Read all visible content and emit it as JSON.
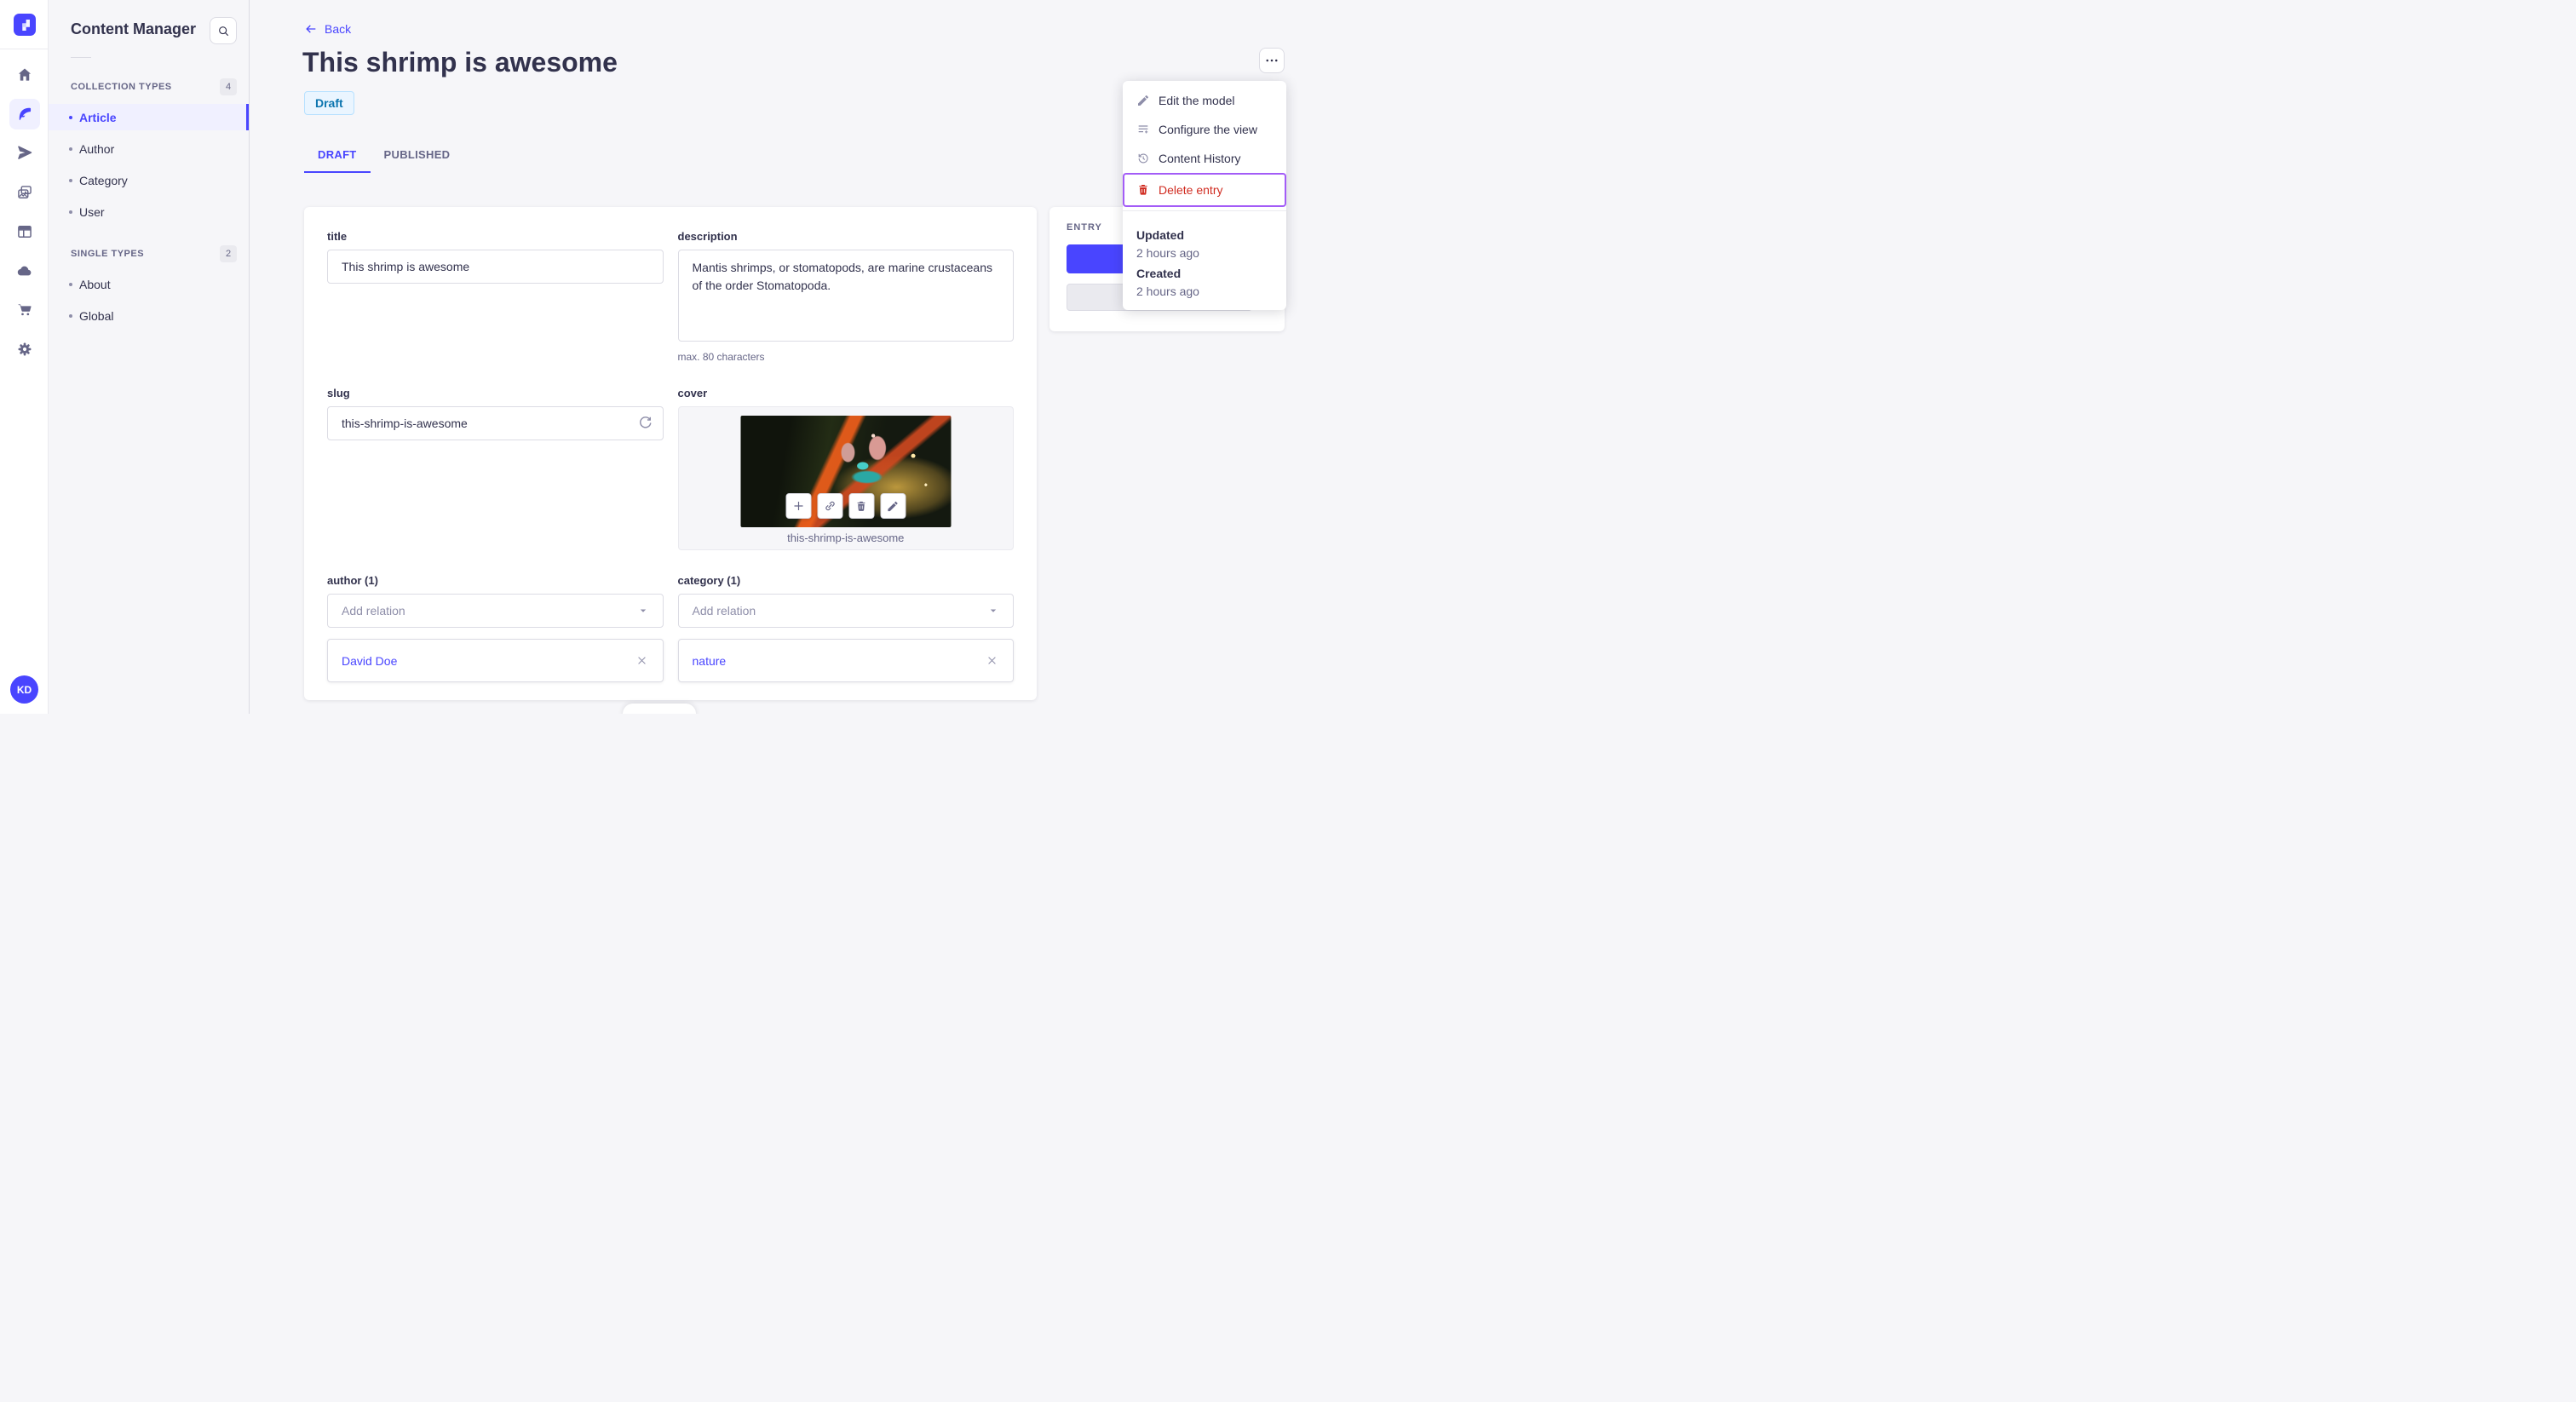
{
  "colors": {
    "primary": "#4945ff",
    "primary_bg": "#f0f0ff",
    "danger": "#d02b20",
    "focus_ring": "#a35cf7",
    "text": "#32324d",
    "muted": "#666687",
    "draft_badge_bg": "#eaf5ff",
    "draft_badge_text": "#0c75af"
  },
  "rail": {
    "logo_icon": "strapi-logo",
    "items": [
      {
        "icon": "home-icon",
        "active": false
      },
      {
        "icon": "feather-icon",
        "active": true
      },
      {
        "icon": "paper-plane-icon",
        "active": false
      },
      {
        "icon": "media-library-icon",
        "active": false
      },
      {
        "icon": "layout-icon",
        "active": false
      },
      {
        "icon": "cloud-icon",
        "active": false
      },
      {
        "icon": "cart-icon",
        "active": false
      },
      {
        "icon": "gear-icon",
        "active": false
      }
    ],
    "avatar": "KD"
  },
  "subnav": {
    "title": "Content Manager",
    "sections": [
      {
        "label": "COLLECTION TYPES",
        "count": "4",
        "items": [
          {
            "label": "Article",
            "active": true
          },
          {
            "label": "Author",
            "active": false
          },
          {
            "label": "Category",
            "active": false
          },
          {
            "label": "User",
            "active": false
          }
        ]
      },
      {
        "label": "SINGLE TYPES",
        "count": "2",
        "items": [
          {
            "label": "About",
            "active": false
          },
          {
            "label": "Global",
            "active": false
          }
        ]
      }
    ]
  },
  "header": {
    "back_label": "Back",
    "title": "This shrimp is awesome",
    "status_badge": "Draft",
    "tabs": [
      {
        "label": "DRAFT",
        "active": true
      },
      {
        "label": "PUBLISHED",
        "active": false
      }
    ]
  },
  "form": {
    "title": {
      "label": "title",
      "value": "This shrimp is awesome"
    },
    "description": {
      "label": "description",
      "value": "Mantis shrimps, or stomatopods, are marine crustaceans of the order Stomatopoda.",
      "helper": "max. 80 characters"
    },
    "slug": {
      "label": "slug",
      "value": "this-shrimp-is-awesome"
    },
    "cover": {
      "label": "cover",
      "caption": "this-shrimp-is-awesome"
    },
    "author": {
      "label": "author (1)",
      "placeholder": "Add relation",
      "items": [
        {
          "label": "David Doe"
        }
      ]
    },
    "category": {
      "label": "category (1)",
      "placeholder": "Add relation",
      "items": [
        {
          "label": "nature"
        }
      ]
    }
  },
  "entry_panel": {
    "label": "ENTRY"
  },
  "menu": {
    "items": [
      {
        "label": "Edit the model",
        "icon": "pencil-icon"
      },
      {
        "label": "Configure the view",
        "icon": "configure-view-icon"
      },
      {
        "label": "Content History",
        "icon": "history-icon"
      },
      {
        "label": "Delete entry",
        "icon": "trash-icon",
        "danger": true
      }
    ],
    "meta": [
      {
        "label": "Updated",
        "value": "2 hours ago"
      },
      {
        "label": "Created",
        "value": "2 hours ago"
      }
    ]
  }
}
